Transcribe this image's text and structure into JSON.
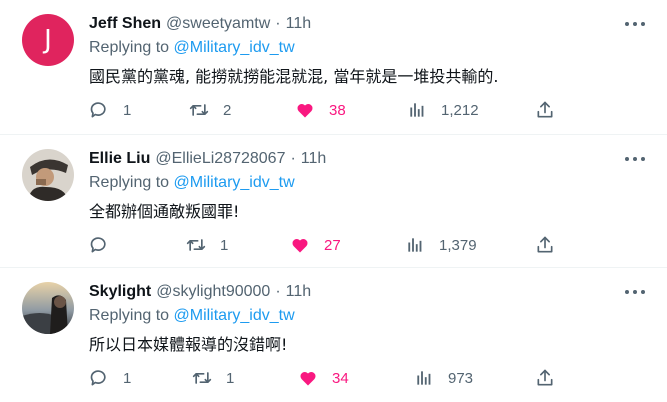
{
  "tweets": [
    {
      "avatar_letter": "J",
      "name": "Jeff Shen",
      "handle": "@sweetyamtw",
      "time": "11h",
      "reply_prefix": "Replying to",
      "reply_to": "@Military_idv_tw",
      "text": "國民黨的黨魂, 能撈就撈能混就混, 當年就是一堆投共輸的.",
      "replies": "1",
      "retweets": "2",
      "likes": "38",
      "views": "1,212"
    },
    {
      "name": "Ellie Liu",
      "handle": "@EllieLi28728067",
      "time": "11h",
      "reply_prefix": "Replying to",
      "reply_to": "@Military_idv_tw",
      "text": "全都辦個通敵叛國罪!",
      "replies": "",
      "retweets": "1",
      "likes": "27",
      "views": "1,379"
    },
    {
      "name": "Skylight",
      "handle": "@skylight90000",
      "time": "11h",
      "reply_prefix": "Replying to",
      "reply_to": "@Military_idv_tw",
      "text": "所以日本媒體報導的沒錯啊!",
      "replies": "1",
      "retweets": "1",
      "likes": "34",
      "views": "973"
    }
  ],
  "colors": {
    "link": "#1d9bf0",
    "like": "#f91880",
    "muted": "#536471",
    "avatar_bg": "#e0245e"
  },
  "icons": [
    "reply-icon",
    "retweet-icon",
    "heart-icon",
    "views-icon",
    "share-icon",
    "more-icon"
  ]
}
